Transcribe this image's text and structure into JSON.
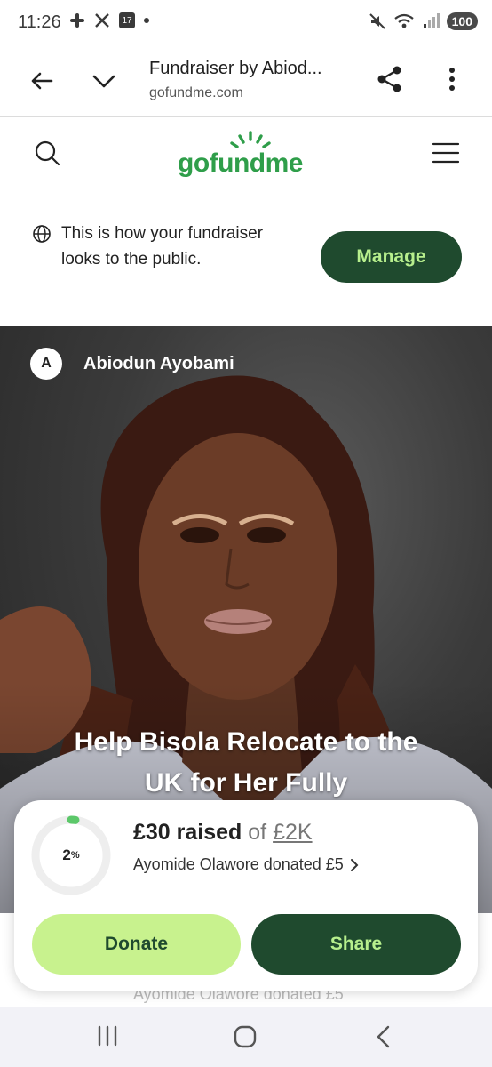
{
  "status_bar": {
    "time": "11:26",
    "battery": "100",
    "left_icons": [
      "slack-icon",
      "x-icon",
      "calendar-icon",
      "dot-icon"
    ],
    "calendar_day": "17",
    "right_icons": [
      "mute-icon",
      "wifi-icon",
      "signal-icon",
      "battery-icon"
    ]
  },
  "browser": {
    "title": "Fundraiser by Abiod...",
    "url": "gofundme.com"
  },
  "site": {
    "logo_text": "gofundme",
    "brand_color": "#2f9e4a",
    "dark_green": "#1f4a2e",
    "light_green": "#c8f28e"
  },
  "notice": {
    "text": "This is how your fundraiser looks to the public.",
    "manage_label": "Manage"
  },
  "hero": {
    "organizer_initial": "A",
    "organizer_name": "Abiodun Ayobami",
    "title": "Help Bisola Relocate to the UK for Her Fully"
  },
  "donation": {
    "progress_percent": 2,
    "progress_label": "2",
    "progress_suffix": "%",
    "raised_amount": "£30 raised",
    "of_text": "of",
    "goal": "£2K",
    "recent_donation": "Ayomide Olawore donated £5",
    "donate_label": "Donate",
    "share_label": "Share"
  },
  "ghost": {
    "text": "Ayomide Olawore donated £5"
  }
}
